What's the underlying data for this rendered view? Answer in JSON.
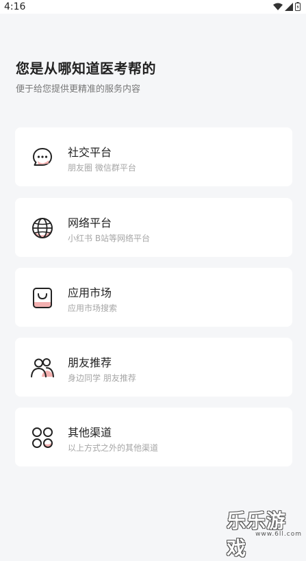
{
  "status_bar": {
    "time": "4:16"
  },
  "header": {
    "title": "您是从哪知道医考帮的",
    "subtitle": "便于给您提供更精准的服务内容"
  },
  "options": [
    {
      "title": "社交平台",
      "desc": "朋友圈 微信群平台",
      "icon": "chat-bubble-icon"
    },
    {
      "title": "网络平台",
      "desc": "小红书 B站等网络平台",
      "icon": "globe-icon"
    },
    {
      "title": "应用市场",
      "desc": "应用市场搜索",
      "icon": "shopping-bag-icon"
    },
    {
      "title": "朋友推荐",
      "desc": "身边同学 朋友推荐",
      "icon": "people-icon"
    },
    {
      "title": "其他渠道",
      "desc": "以上方式之外的其他渠道",
      "icon": "grid-icon"
    }
  ],
  "watermark": {
    "main": "乐乐游戏",
    "url": "www.6ll.com"
  },
  "colors": {
    "accent": "#f2a7a7",
    "background": "#f5f6f8",
    "card": "#ffffff"
  }
}
